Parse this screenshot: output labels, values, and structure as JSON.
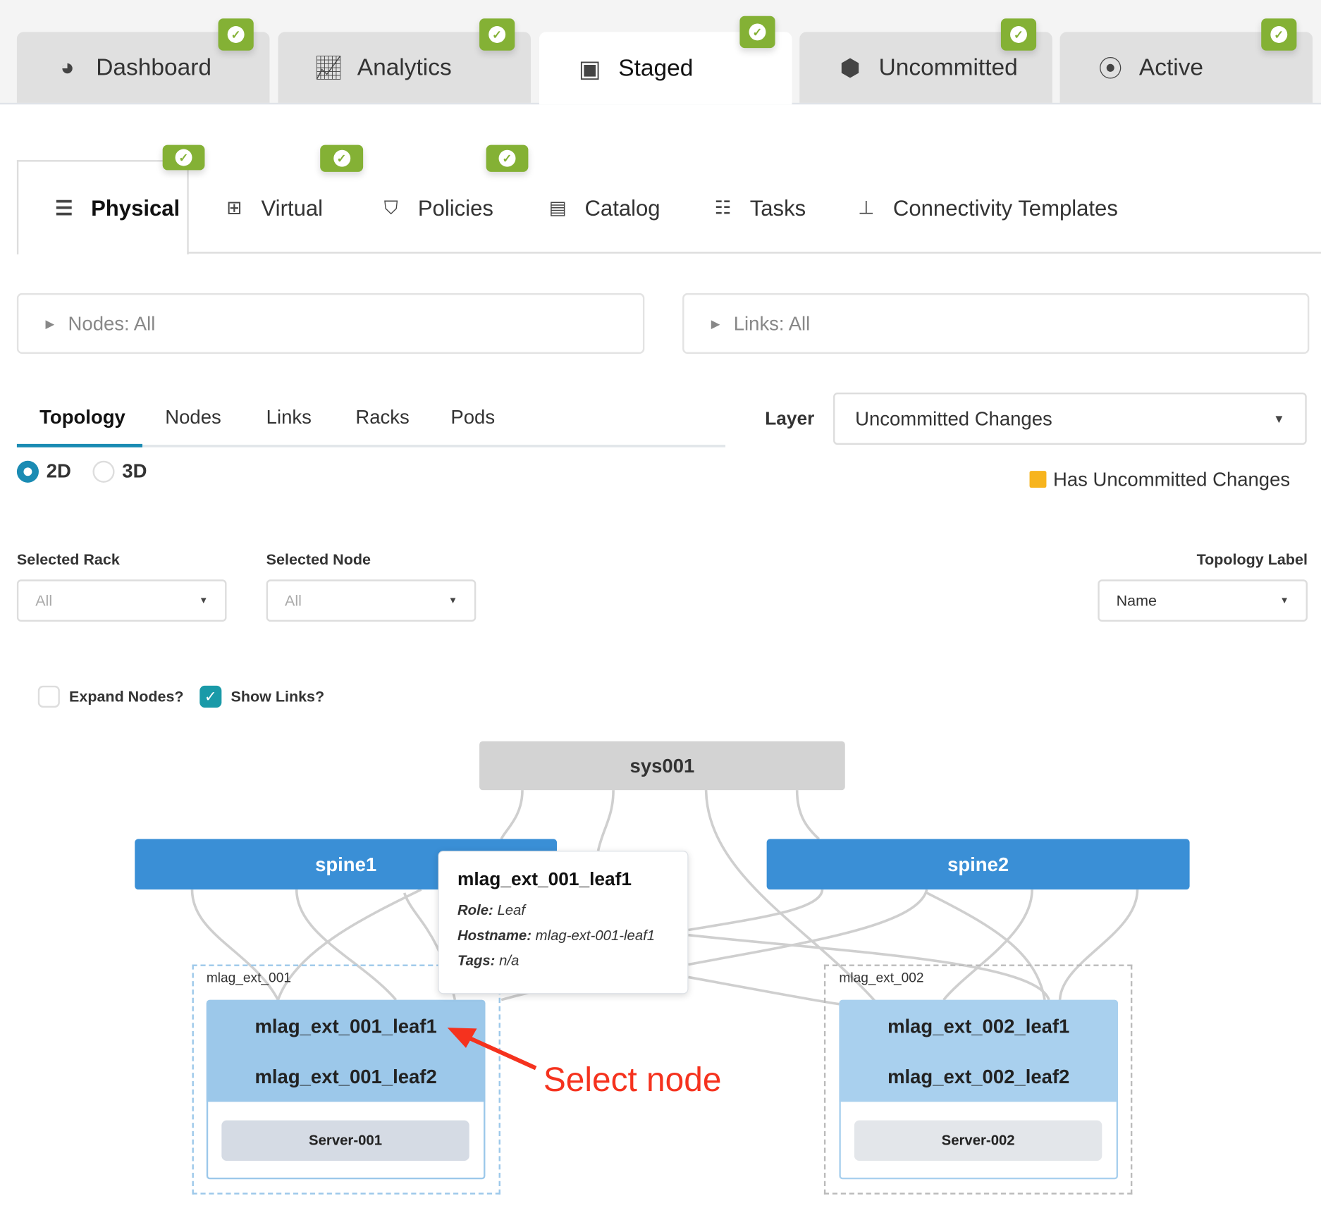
{
  "top_tabs": [
    {
      "label": "Dashboard",
      "icon": "gauge-icon",
      "status": "ok"
    },
    {
      "label": "Analytics",
      "icon": "chart-line-icon",
      "status": "ok"
    },
    {
      "label": "Staged",
      "icon": "staged-box-icon",
      "status": "ok",
      "active": true
    },
    {
      "label": "Uncommitted",
      "icon": "cubes-icon",
      "status": "ok"
    },
    {
      "label": "Active",
      "icon": "active-cube-icon",
      "status": "ok"
    }
  ],
  "sub_tabs": [
    {
      "label": "Physical",
      "icon": "server-rack-icon",
      "active": true,
      "status": "ok"
    },
    {
      "label": "Virtual",
      "icon": "network-icon",
      "status": "ok"
    },
    {
      "label": "Policies",
      "icon": "shield-icon",
      "status": "ok"
    },
    {
      "label": "Catalog",
      "icon": "list-box-icon"
    },
    {
      "label": "Tasks",
      "icon": "tasks-icon"
    },
    {
      "label": "Connectivity Templates",
      "icon": "hierarchy-icon"
    }
  ],
  "filters": {
    "nodes": "Nodes: All",
    "links": "Links: All"
  },
  "view_tabs": [
    "Topology",
    "Nodes",
    "Links",
    "Racks",
    "Pods"
  ],
  "layer": {
    "label": "Layer",
    "value": "Uncommitted Changes"
  },
  "legend": {
    "label": "Has Uncommitted Changes",
    "color": "#f7b41d"
  },
  "dimension": {
    "options": [
      "2D",
      "3D"
    ],
    "selected": "2D"
  },
  "selected_rack": {
    "label": "Selected Rack",
    "value": "All"
  },
  "selected_node": {
    "label": "Selected Node",
    "value": "All"
  },
  "topology_label": {
    "label": "Topology Label",
    "value": "Name"
  },
  "options": {
    "expand_nodes": {
      "label": "Expand Nodes?",
      "checked": false
    },
    "show_links": {
      "label": "Show Links?",
      "checked": true
    }
  },
  "topology": {
    "system": "sys001",
    "spines": [
      "spine1",
      "spine2"
    ],
    "racks": [
      {
        "name": "mlag_ext_001",
        "leafs": [
          "mlag_ext_001_leaf1",
          "mlag_ext_001_leaf2"
        ],
        "server": "Server-001"
      },
      {
        "name": "mlag_ext_002",
        "leafs": [
          "mlag_ext_002_leaf1",
          "mlag_ext_002_leaf2"
        ],
        "server": "Server-002"
      }
    ]
  },
  "tooltip": {
    "title": "mlag_ext_001_leaf1",
    "role_label": "Role:",
    "role": "Leaf",
    "hostname_label": "Hostname:",
    "hostname": "mlag-ext-001-leaf1",
    "tags_label": "Tags:",
    "tags": "n/a"
  },
  "annotation": {
    "text": "Select node",
    "color": "#f5321e"
  },
  "colors": {
    "accent": "#1a8bb3",
    "spine": "#3a8fd6",
    "leaf": "#9cc8ea",
    "ok_badge": "#84b135"
  }
}
